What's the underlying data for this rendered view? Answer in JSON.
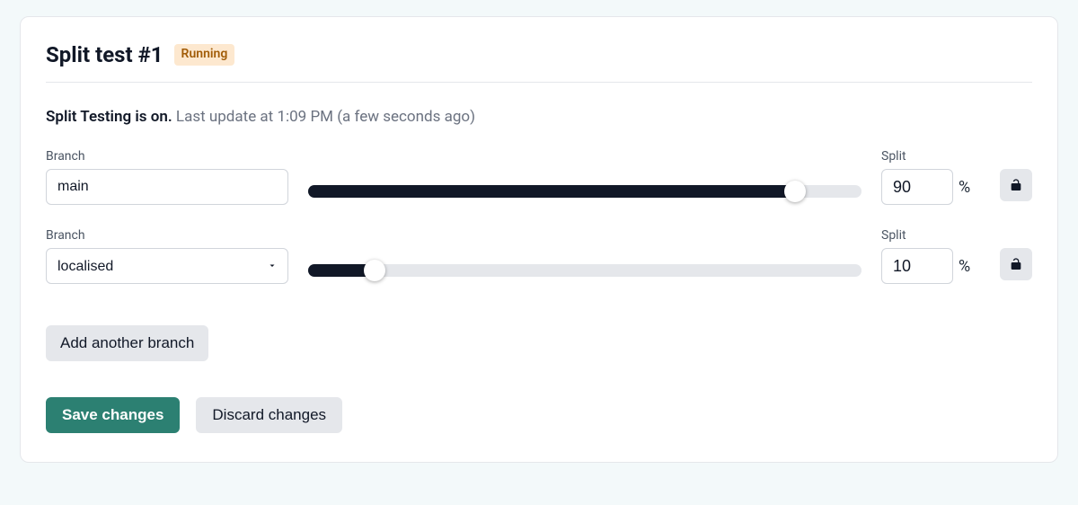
{
  "header": {
    "title": "Split test #1",
    "badge": "Running"
  },
  "status": {
    "main": "Split Testing is on.",
    "sub": "Last update at 1:09 PM (a few seconds ago)"
  },
  "labels": {
    "branch": "Branch",
    "split": "Split",
    "percent": "%"
  },
  "rows": [
    {
      "branch_value": "main",
      "percent": "90",
      "as_select": false,
      "lock_state": "unlocked"
    },
    {
      "branch_value": "localised",
      "percent": "10",
      "as_select": true,
      "lock_state": "unlocked"
    }
  ],
  "buttons": {
    "add_branch": "Add another branch",
    "save": "Save changes",
    "discard": "Discard changes"
  },
  "colors": {
    "primary": "#2c8072",
    "badge_bg": "#fde8cf",
    "badge_fg": "#a15c07"
  }
}
